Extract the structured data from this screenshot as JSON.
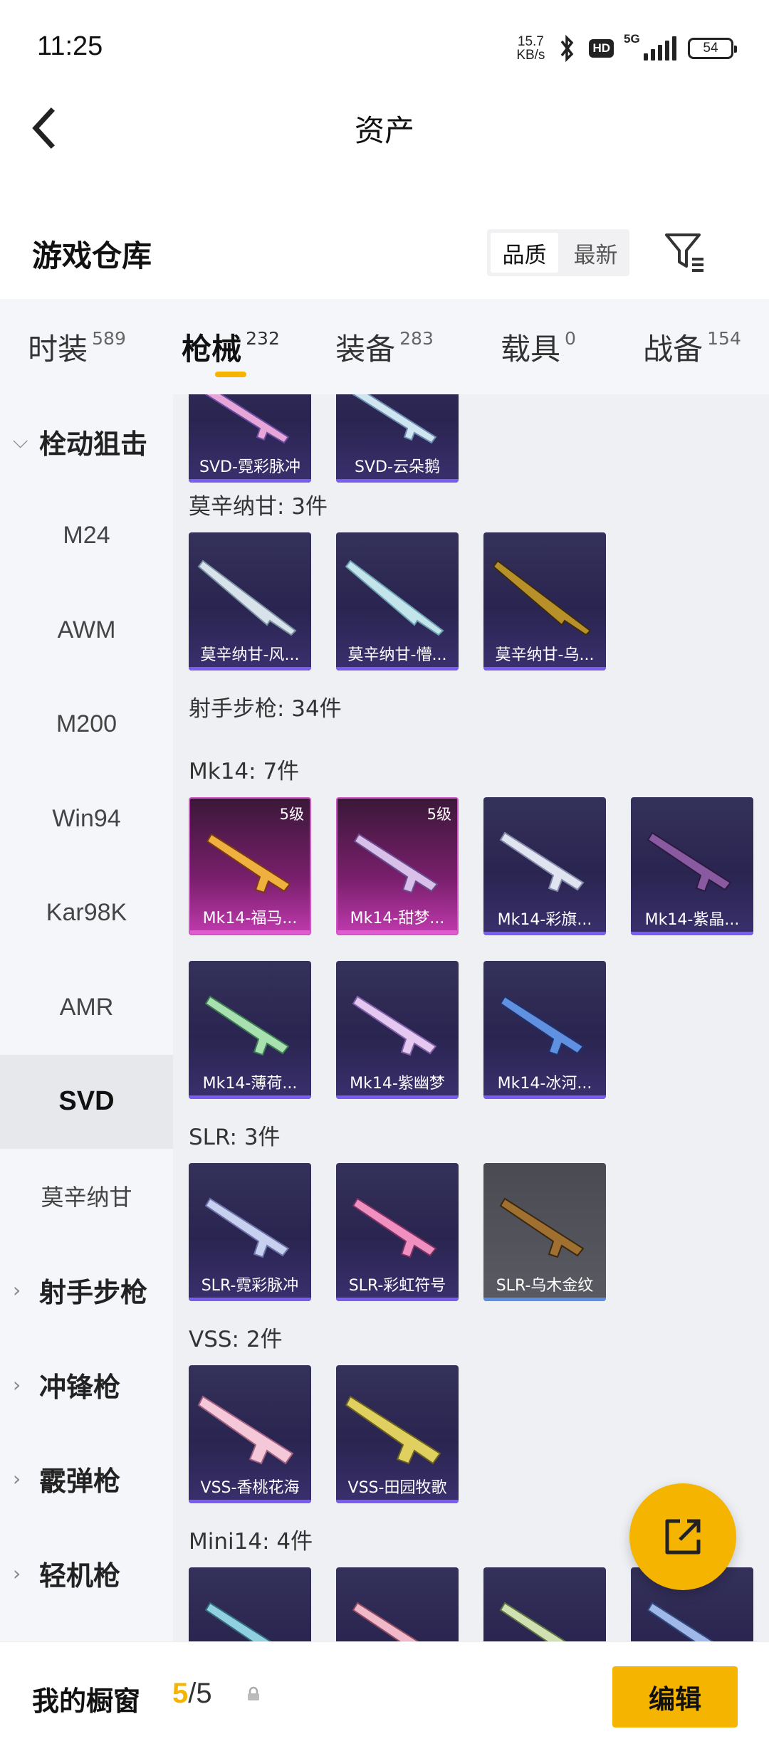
{
  "status_bar": {
    "time": "11:25",
    "net_speed_value": "15.7",
    "net_speed_unit": "KB/s",
    "hd": "HD",
    "network": "5G",
    "battery": "54"
  },
  "header": {
    "title": "资产"
  },
  "warehouse": {
    "title": "游戏仓库",
    "sort_options": [
      "品质",
      "最新"
    ],
    "sort_selected": "品质"
  },
  "tabs": [
    {
      "label": "时装",
      "count": "589"
    },
    {
      "label": "枪械",
      "count": "232",
      "active": true
    },
    {
      "label": "装备",
      "count": "283"
    },
    {
      "label": "载具",
      "count": "0"
    },
    {
      "label": "战备",
      "count": "154"
    }
  ],
  "sidebar": {
    "group_bolt": "栓动狙击",
    "items": [
      "M24",
      "AWM",
      "M200",
      "Win94",
      "Kar98K",
      "AMR",
      "SVD",
      "莫辛纳甘"
    ],
    "selected": "SVD",
    "groups": [
      "射手步枪",
      "冲锋枪",
      "霰弹枪",
      "轻机枪"
    ]
  },
  "content": {
    "svd_items": [
      "SVD-霓彩脉冲",
      "SVD-云朵鹅"
    ],
    "mosin_label": "莫辛纳甘: 3件",
    "mosin_items": [
      "莫辛纳甘-风...",
      "莫辛纳甘-懵...",
      "莫辛纳甘-乌..."
    ],
    "dmr_label": "射手步枪: 34件",
    "mk14_label": "Mk14: 7件",
    "mk14_items": [
      {
        "name": "Mk14-福马...",
        "level": "5级"
      },
      {
        "name": "Mk14-甜梦...",
        "level": "5级"
      },
      {
        "name": "Mk14-彩旗..."
      },
      {
        "name": "Mk14-紫晶..."
      },
      {
        "name": "Mk14-薄荷..."
      },
      {
        "name": "Mk14-紫幽梦"
      },
      {
        "name": "Mk14-冰河..."
      }
    ],
    "slr_label": "SLR: 3件",
    "slr_items": [
      "SLR-霓彩脉冲",
      "SLR-彩虹符号",
      "SLR-乌木金纹"
    ],
    "vss_label": "VSS: 2件",
    "vss_items": [
      "VSS-香桃花海",
      "VSS-田园牧歌"
    ],
    "mini14_label": "Mini14: 4件"
  },
  "bottom_bar": {
    "title": "我的橱窗",
    "count_current": "5",
    "count_rest": "/5",
    "edit_label": "编辑"
  },
  "icons": {
    "back": "back-arrow-icon",
    "filter": "filter-icon",
    "share": "share-icon",
    "lock": "lock-icon"
  },
  "colors": {
    "accent": "#f5b400",
    "card_purple": "#2a2550",
    "card_pink": "#c03aae"
  }
}
